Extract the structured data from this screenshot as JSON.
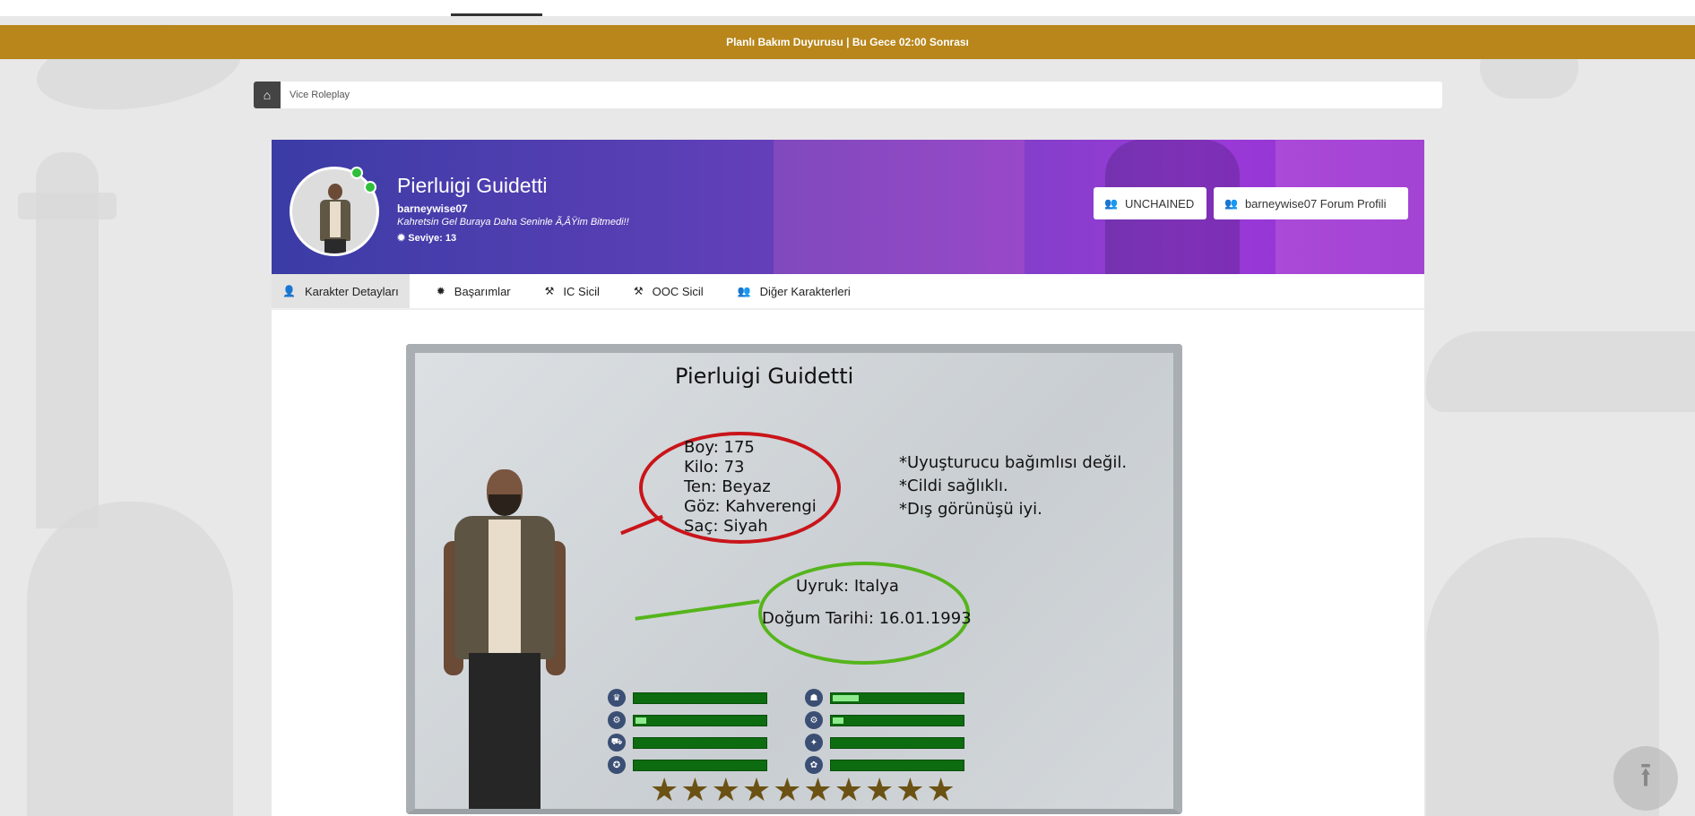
{
  "notice": "Planlı Bakım Duyurusu | Bu Gece 02:00 Sonrası",
  "breadcrumb": {
    "home_icon": "home-icon",
    "item": "Vice Roleplay"
  },
  "profile": {
    "name": "Pierluigi Guidetti",
    "username": "barneywise07",
    "quote": "Kahretsin Gel Buraya Daha Seninle Ã‚ÂŸim Bitmedi!!",
    "level": "Seviye: 13",
    "buttons": {
      "gang": "UNCHAINED",
      "forum": "barneywise07 Forum Profili"
    }
  },
  "tabs": [
    {
      "label": "Karakter Detayları",
      "icon": "user-icon",
      "active": true
    },
    {
      "label": "Başarımlar",
      "icon": "badge-icon"
    },
    {
      "label": "IC Sicil",
      "icon": "gavel-icon"
    },
    {
      "label": "OOC Sicil",
      "icon": "gavel-icon"
    },
    {
      "label": "Diğer Karakterleri",
      "icon": "users-icon"
    }
  ],
  "board": {
    "title": "Pierluigi Guidetti",
    "stats": [
      "Boy: 175",
      "Kilo: 73",
      "Ten: Beyaz",
      "Göz: Kahverengi",
      "Saç: Siyah"
    ],
    "notes": [
      "*Uyuşturucu bağımlısı değil.",
      "*Cildi sağlıklı.",
      "*Dış görünüşü iyi."
    ],
    "nationality": "Uyruk: Italya",
    "birthdate": "Doğum Tarihi: 16.01.1993",
    "skill_bars": {
      "left": [
        {
          "icon": "skill-icon-1",
          "level": 1.0
        },
        {
          "icon": "skill-icon-2",
          "level": 0.08
        },
        {
          "icon": "skill-icon-3",
          "level": 1.0
        },
        {
          "icon": "skill-icon-4",
          "level": 1.0
        }
      ],
      "right": [
        {
          "icon": "skill-icon-5",
          "level": 0.2
        },
        {
          "icon": "skill-icon-6",
          "level": 0.08
        },
        {
          "icon": "skill-icon-7",
          "level": 1.0
        },
        {
          "icon": "skill-icon-8",
          "level": 1.0
        }
      ]
    },
    "stars": {
      "count": 10,
      "glyph": "★"
    }
  }
}
